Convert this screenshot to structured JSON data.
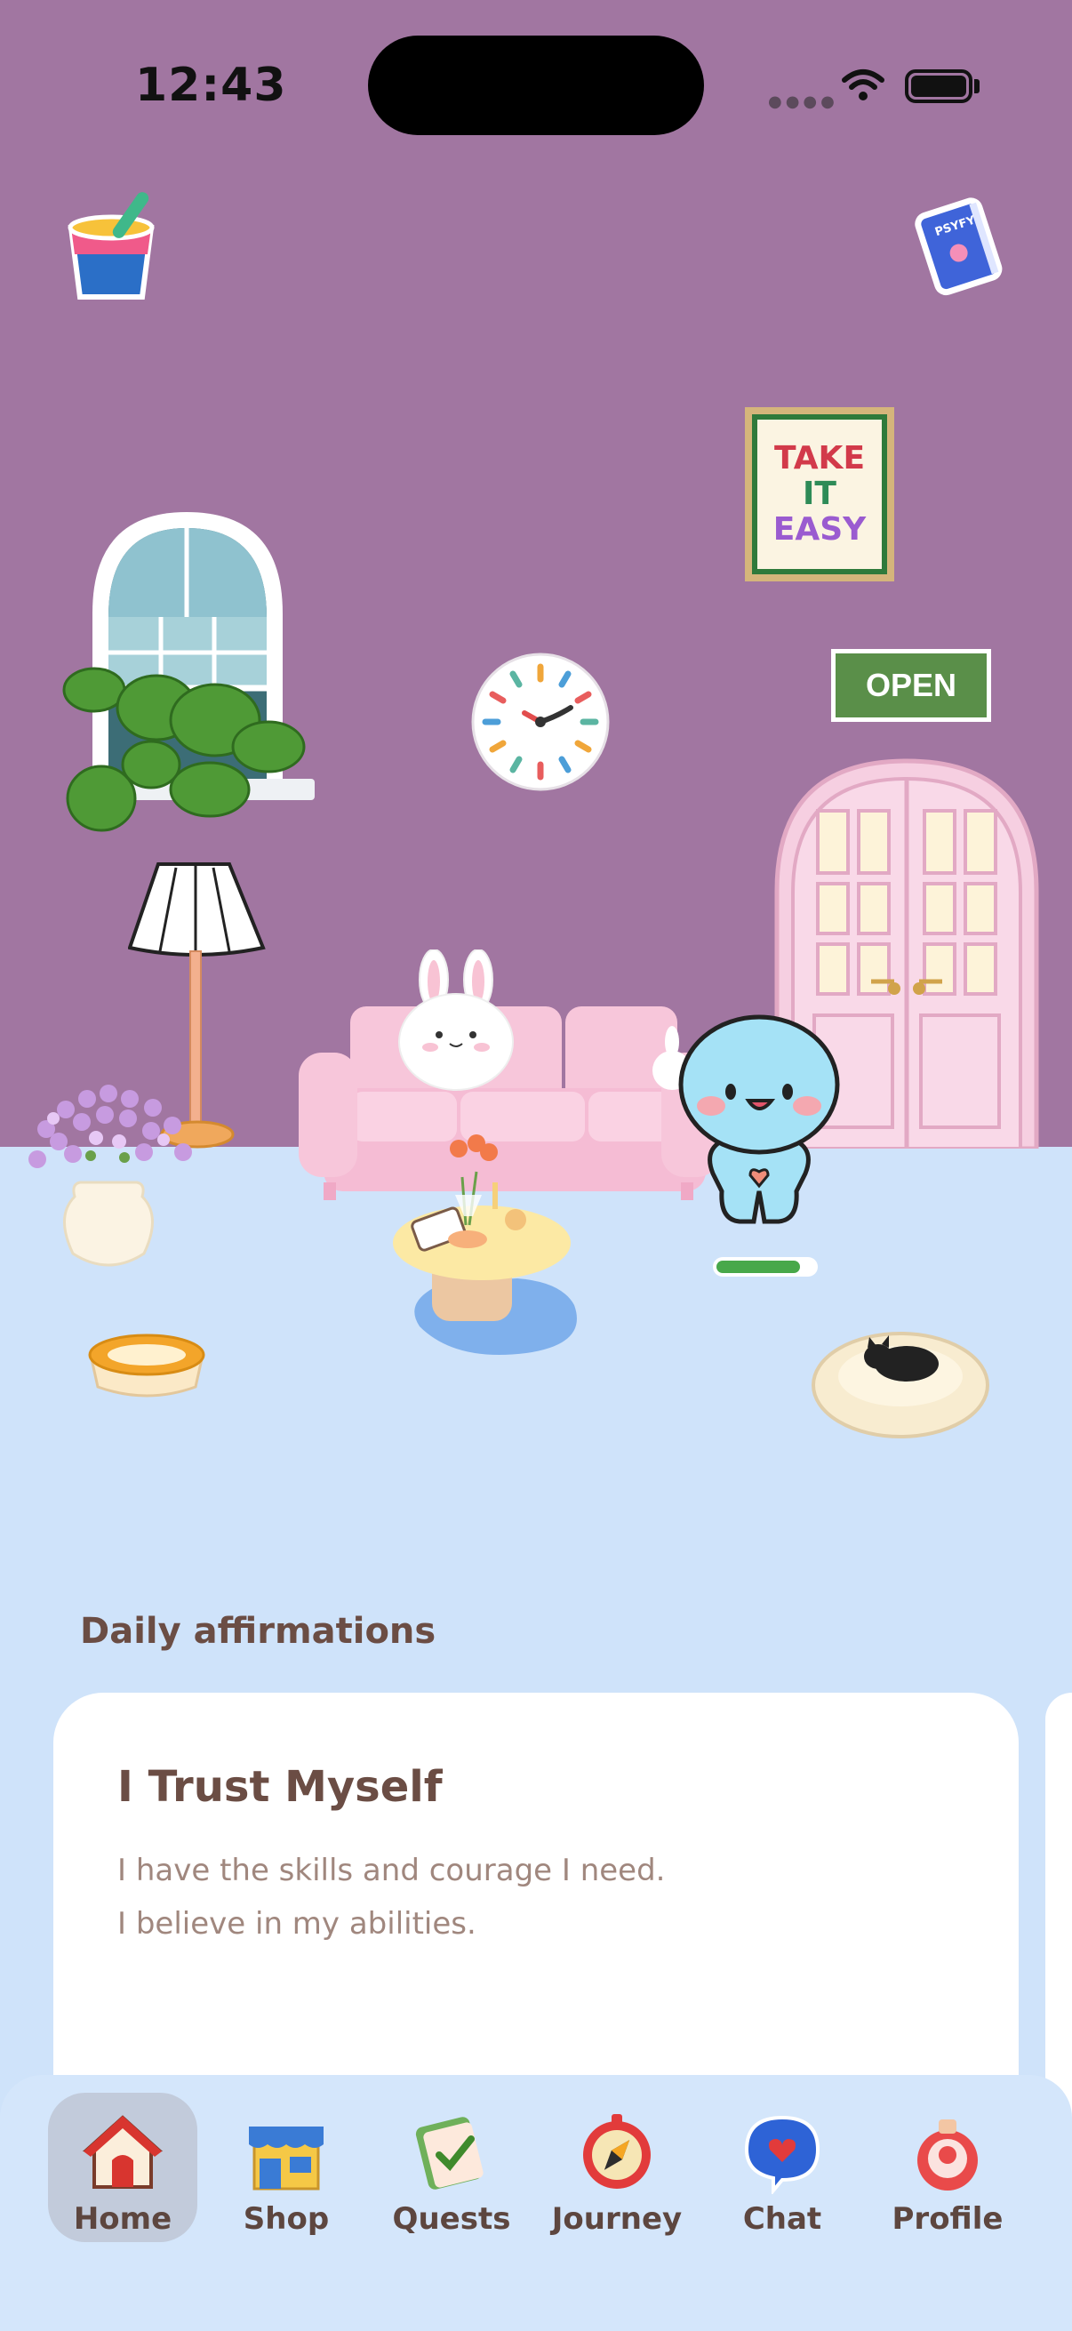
{
  "status_bar": {
    "time": "12:43"
  },
  "room": {
    "poster_lines": [
      "TAKE",
      "IT",
      "EASY"
    ],
    "sign_text": "OPEN",
    "pet_health": 0.85,
    "wall_color": "#a176a1",
    "floor_color": "#cfe3fa"
  },
  "affirmations": {
    "section_title": "Daily affirmations",
    "card": {
      "title": "I Trust Myself",
      "lines": [
        "I have the skills and courage I need.",
        "I believe in my abilities."
      ]
    }
  },
  "nav": {
    "items": [
      {
        "label": "Home",
        "icon": "house-icon",
        "active": true
      },
      {
        "label": "Shop",
        "icon": "shop-icon",
        "active": false
      },
      {
        "label": "Quests",
        "icon": "quests-icon",
        "active": false
      },
      {
        "label": "Journey",
        "icon": "compass-icon",
        "active": false
      },
      {
        "label": "Chat",
        "icon": "chat-icon",
        "active": false
      },
      {
        "label": "Profile",
        "icon": "profile-icon",
        "active": false
      }
    ]
  }
}
